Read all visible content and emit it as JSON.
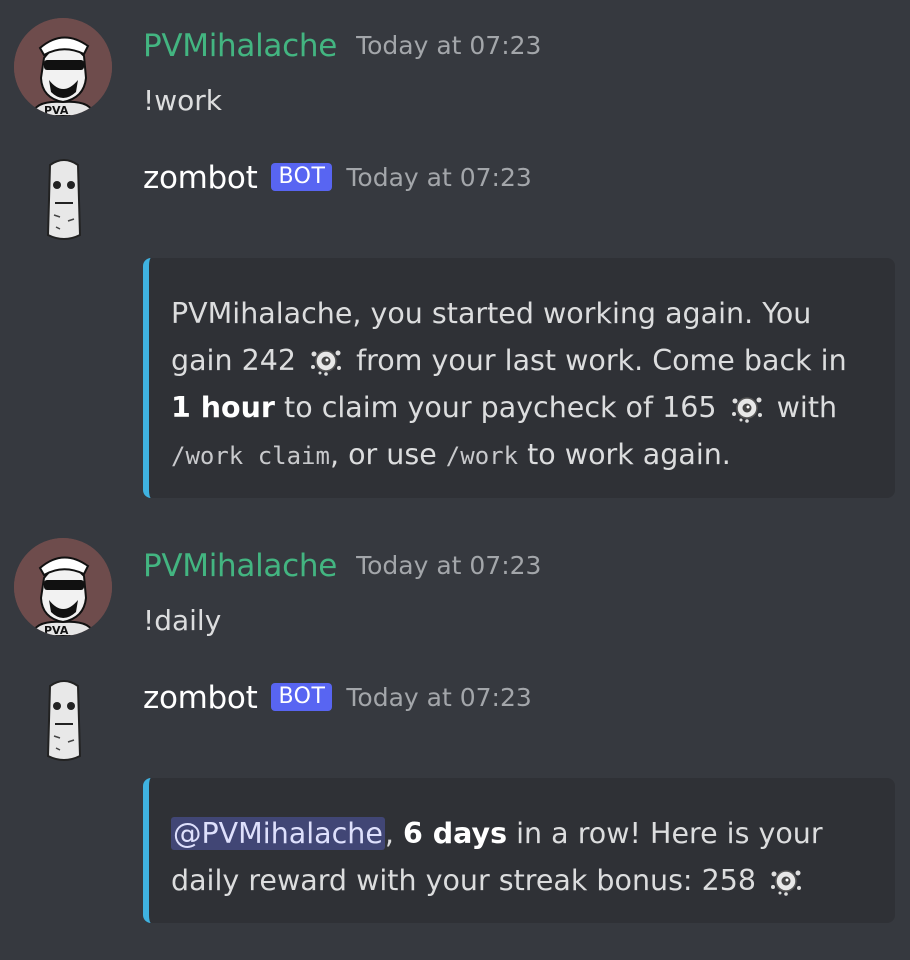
{
  "messages": [
    {
      "author": "PVMihalache",
      "timestamp": "Today at 07:23",
      "text": "!work"
    },
    {
      "author": "zombot",
      "bot_tag": "BOT",
      "timestamp": "Today at 07:23",
      "embed": {
        "mention": "PVMihalache",
        "part1": ", you started working again. You gain 242",
        "part2": "from your last work. Come back in",
        "bold1": "1 hour",
        "part3": "to claim your paycheck of 165",
        "part4": "with",
        "code1": "/work claim",
        "part5": ", or use",
        "code2": "/work",
        "part6": "to work again."
      }
    },
    {
      "author": "PVMihalache",
      "timestamp": "Today at 07:23",
      "text": "!daily"
    },
    {
      "author": "zombot",
      "bot_tag": "BOT",
      "timestamp": "Today at 07:23",
      "embed": {
        "mention": "@PVMihalache",
        "comma": ",",
        "bold1": "6 days",
        "part1": "in a row! Here is your daily reward with your streak bonus: 258"
      }
    }
  ],
  "colors": {
    "background": "#36393f",
    "embed_background": "#2f3136",
    "embed_border": "#3fb2e0",
    "user_name": "#43b581",
    "bot_tag": "#5865f2"
  },
  "icons": {
    "coin": "zombie-coin-icon",
    "user_avatar": "pv-avatar-icon",
    "bot_avatar": "zombot-avatar-icon"
  }
}
